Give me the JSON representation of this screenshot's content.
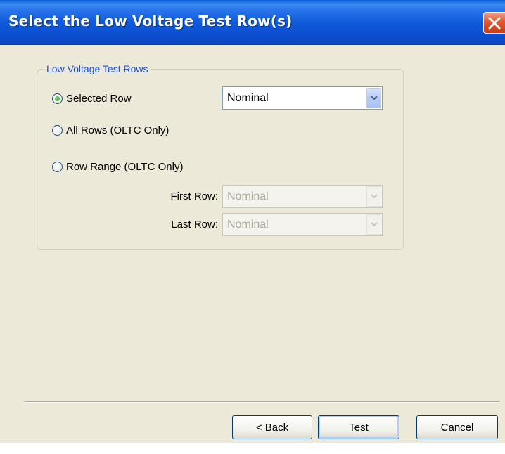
{
  "window": {
    "title": "Select the Low Voltage Test Row(s)"
  },
  "group": {
    "legend": "Low Voltage Test Rows",
    "options": [
      {
        "label": "Selected Row",
        "checked": true
      },
      {
        "label": "All Rows (OLTC Only)",
        "checked": false
      },
      {
        "label": "Row Range (OLTC Only)",
        "checked": false
      }
    ],
    "selected_row_value": "Nominal",
    "first_row_label": "First Row:",
    "first_row_value": "Nominal",
    "last_row_label": "Last Row:",
    "last_row_value": "Nominal"
  },
  "buttons": {
    "back": "< Back",
    "test": "Test",
    "cancel": "Cancel"
  },
  "icons": {
    "close": "close-icon",
    "dropdown": "chevron-down-icon"
  },
  "colors": {
    "title_bar": "#0a47c4",
    "close_button": "#e0582e",
    "legend_text": "#1c50d8",
    "dialog_background": "#ece9d8"
  }
}
